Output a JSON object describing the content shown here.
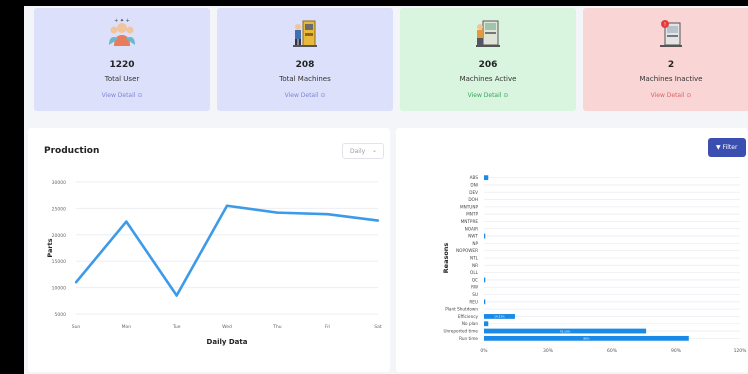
{
  "cards": [
    {
      "value": "1220",
      "label": "Total User",
      "detail": "View Detail",
      "bg": "#dde0fb",
      "link": "#7c84d6"
    },
    {
      "value": "208",
      "label": "Total Machines",
      "detail": "View Detail",
      "bg": "#dde0fb",
      "link": "#7c84d6"
    },
    {
      "value": "206",
      "label": "Machines Active",
      "detail": "View Detail",
      "bg": "#d9f5df",
      "link": "#3aa35a"
    },
    {
      "value": "2",
      "label": "Machines Inactive",
      "detail": "View Detail",
      "bg": "#f9d5d5",
      "link": "#e06060"
    }
  ],
  "production": {
    "title": "Production",
    "period_select": "Daily",
    "chart_data": {
      "type": "line",
      "categories": [
        "Sun",
        "Mon",
        "Tue",
        "Wed",
        "Thu",
        "Fri",
        "Sat"
      ],
      "series": [
        {
          "values": [
            11000,
            22500,
            8500,
            25500,
            24200,
            23900,
            22700
          ]
        }
      ],
      "ylim": [
        5000,
        30000
      ],
      "yticks": [
        5000,
        10000,
        15000,
        20000,
        25000,
        30000
      ],
      "xlabel": "Daily Data",
      "ylabel": "Parts",
      "grid": true,
      "color": "#3d9ae8"
    }
  },
  "reasons": {
    "filter_label": "Filter",
    "chart_data": {
      "type": "bar",
      "orientation": "horizontal",
      "categories": [
        "ABS",
        "DNI",
        "DEV",
        "DOH",
        "MNTUNP",
        "MNTP",
        "MNTPRE",
        "NOAIR",
        "NWT",
        "NP",
        "NOPOWER",
        "NTL",
        "NR",
        "OLL",
        "QC",
        "RW",
        "SU",
        "REU",
        "Plant Shutdown",
        "Efficiency",
        "No plan",
        "Unreported time",
        "Run time"
      ],
      "values": [
        2,
        0,
        0,
        0,
        0,
        0,
        0,
        0,
        0.6,
        0,
        0,
        0,
        0,
        0,
        0.6,
        0,
        0,
        0.6,
        0,
        14.5,
        2,
        76,
        96
      ],
      "value_labels": [
        "",
        "",
        "",
        "",
        "",
        "",
        "",
        "",
        "",
        "",
        "",
        "",
        "",
        "",
        "",
        "",
        "",
        "",
        "",
        "14.53%",
        "",
        "76.19%",
        "96%"
      ],
      "xlim": [
        0,
        120
      ],
      "xticks": [
        "0%",
        "30%",
        "60%",
        "90%",
        "120%"
      ],
      "ylabel": "Reasons",
      "grid": true,
      "color": "#1a8ae8"
    }
  }
}
